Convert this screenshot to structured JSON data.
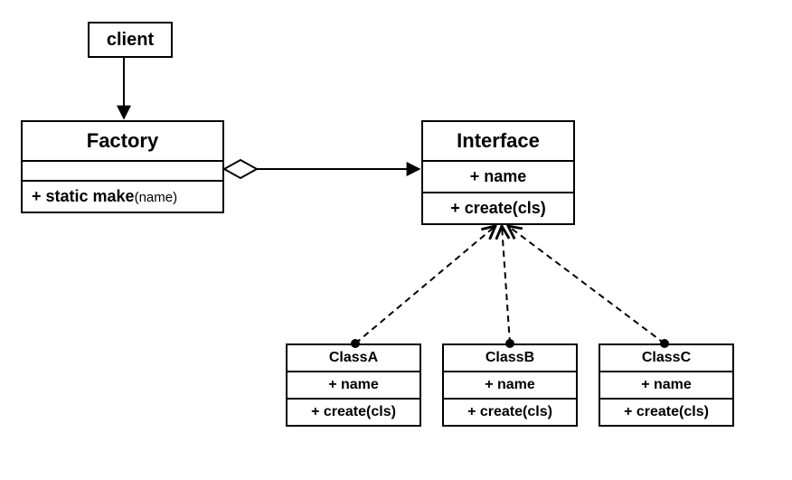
{
  "client": {
    "label": "client"
  },
  "factory": {
    "title": "Factory",
    "empty_row": "",
    "method": "+ static make",
    "method_arg": "(name)"
  },
  "interface": {
    "title": "Interface",
    "attr": "+ name",
    "method": "+ create(cls)"
  },
  "classA": {
    "title": "ClassA",
    "attr": "+ name",
    "method": "+ create(cls)"
  },
  "classB": {
    "title": "ClassB",
    "attr": "+ name",
    "method": "+ create(cls)"
  },
  "classC": {
    "title": "ClassC",
    "attr": "+ name",
    "method": "+ create(cls)"
  }
}
